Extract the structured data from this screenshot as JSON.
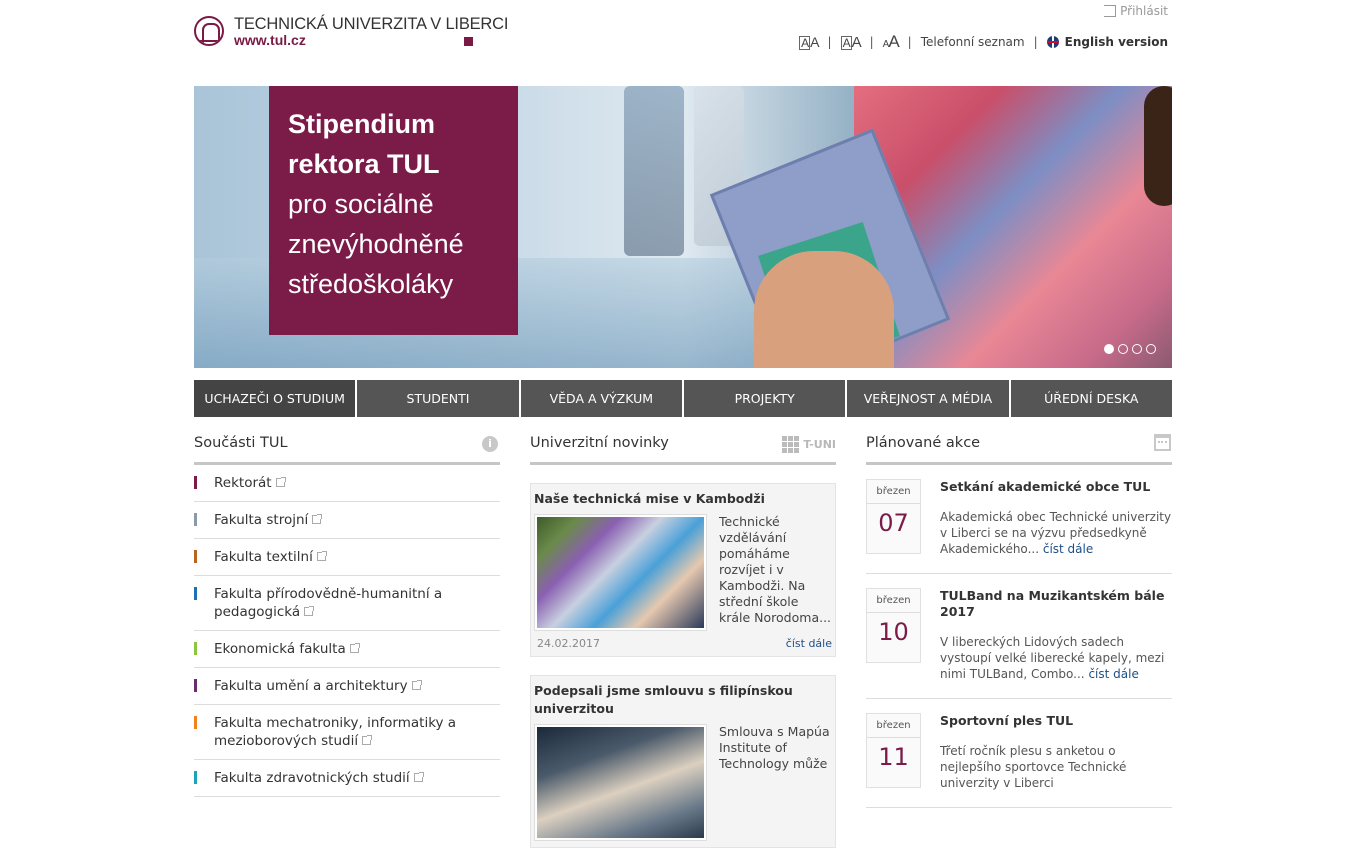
{
  "header": {
    "university_name": "TECHNICKÁ UNIVERZITA V LIBERCI",
    "url": "www.tul.cz",
    "login": "Přihlásit",
    "font_small": "A",
    "font_medium": "A",
    "font_large": "A",
    "phone_directory": "Telefonní seznam",
    "english_version": "English version"
  },
  "hero": {
    "lines": [
      "Stipendium",
      "rektora TUL",
      "pro sociálně",
      "znevýhodněné",
      "středoškoláky"
    ],
    "slides": 4,
    "active_slide": 1
  },
  "nav": [
    "UCHAZEČI O STUDIUM",
    "STUDENTI",
    "VĚDA A VÝZKUM",
    "PROJEKTY",
    "VEŘEJNOST A MÉDIA",
    "ÚŘEDNÍ DESKA"
  ],
  "parts": {
    "title": "Součásti TUL",
    "items": [
      {
        "label": "Rektorát",
        "color": "#7a1b48"
      },
      {
        "label": "Fakulta strojní",
        "color": "#8a9aa8"
      },
      {
        "label": "Fakulta textilní",
        "color": "#b5651d"
      },
      {
        "label": "Fakulta přírodovědně-humanitní a pedagogická",
        "color": "#1e6fb5"
      },
      {
        "label": "Ekonomická fakulta",
        "color": "#8cc63f"
      },
      {
        "label": "Fakulta umění a architektury",
        "color": "#6a2c6e"
      },
      {
        "label": "Fakulta mechatroniky, informatiky a mezioborových studií",
        "color": "#f0821e"
      },
      {
        "label": "Fakulta zdravotnických studií",
        "color": "#1aa6b7"
      }
    ]
  },
  "news": {
    "title": "Univerzitní novinky",
    "badge": "T-UNI",
    "items": [
      {
        "title": "Naše technická mise v Kambodži",
        "text": "Technické vzdělávání pomáháme rozvíjet i v Kambodži. Na střední škole krále Norodoma...",
        "date": "24.02.2017",
        "more": "číst dále"
      },
      {
        "title": "Podepsali jsme smlouvu s filipínskou univerzitou",
        "text": "Smlouva s Mapúa Institute of Technology může",
        "date": "",
        "more": ""
      }
    ]
  },
  "events": {
    "title": "Plánované akce",
    "items": [
      {
        "month": "březen",
        "day": "07",
        "title": "Setkání akademické obce TUL",
        "text": "Akademická obec Technické univerzity v Liberci se na výzvu předsedkyně Akademického...",
        "more": "číst dále"
      },
      {
        "month": "březen",
        "day": "10",
        "title": "TULBand na Muzikantském bále 2017",
        "text": "V libereckých Lidových sadech vystoupí velké liberecké kapely, mezi nimi TULBand, Combo...",
        "more": "číst dále"
      },
      {
        "month": "březen",
        "day": "11",
        "title": "Sportovní ples TUL",
        "text": "Třetí ročník plesu s anketou o nejlepšího sportovce Technické univerzity v Liberci",
        "more": ""
      }
    ]
  }
}
